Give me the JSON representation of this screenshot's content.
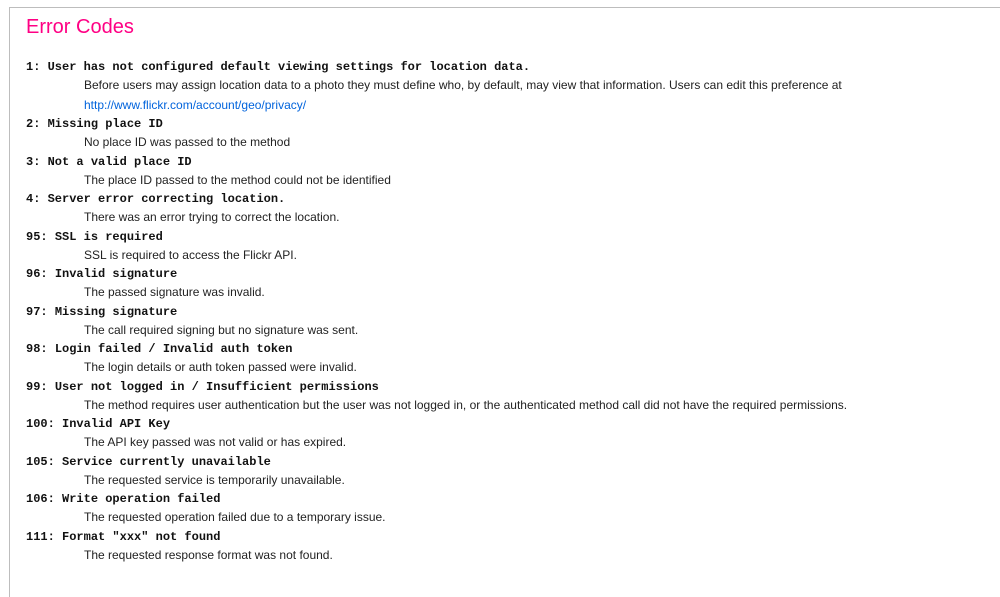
{
  "page": {
    "title": "Error Codes",
    "title_color": "#ff0084",
    "link_color": "#0063dc"
  },
  "errors": [
    {
      "code": "1",
      "title": "User has not configured default viewing settings for location data.",
      "description": "Before users may assign location data to a photo they must define who, by default, may view that information. Users can edit this preference at",
      "link": "http://www.flickr.com/account/geo/privacy/"
    },
    {
      "code": "2",
      "title": "Missing place ID",
      "description": "No place ID was passed to the method"
    },
    {
      "code": "3",
      "title": "Not a valid place ID",
      "description": "The place ID passed to the method could not be identified"
    },
    {
      "code": "4",
      "title": "Server error correcting location.",
      "description": "There was an error trying to correct the location."
    },
    {
      "code": "95",
      "title": "SSL is required",
      "description": "SSL is required to access the Flickr API."
    },
    {
      "code": "96",
      "title": "Invalid signature",
      "description": "The passed signature was invalid."
    },
    {
      "code": "97",
      "title": "Missing signature",
      "description": "The call required signing but no signature was sent."
    },
    {
      "code": "98",
      "title": "Login failed / Invalid auth token",
      "description": "The login details or auth token passed were invalid."
    },
    {
      "code": "99",
      "title": "User not logged in / Insufficient permissions",
      "description": "The method requires user authentication but the user was not logged in, or the authenticated method call did not have the required permissions."
    },
    {
      "code": "100",
      "title": "Invalid API Key",
      "description": "The API key passed was not valid or has expired."
    },
    {
      "code": "105",
      "title": "Service currently unavailable",
      "description": "The requested service is temporarily unavailable."
    },
    {
      "code": "106",
      "title": "Write operation failed",
      "description": "The requested operation failed due to a temporary issue."
    },
    {
      "code": "111",
      "title": "Format \"xxx\" not found",
      "description": "The requested response format was not found."
    }
  ]
}
